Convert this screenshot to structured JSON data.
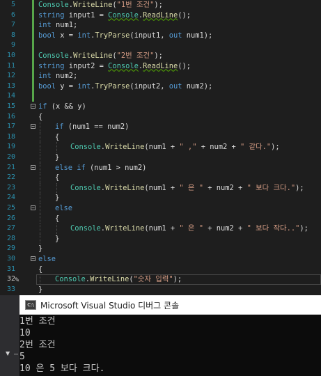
{
  "editor": {
    "line_numbers": [
      "5",
      "6",
      "7",
      "8",
      "9",
      "10",
      "11",
      "12",
      "13",
      "14",
      "15",
      "16",
      "17",
      "18",
      "19",
      "20",
      "21",
      "22",
      "23",
      "24",
      "25",
      "26",
      "27",
      "28",
      "29",
      "30",
      "31",
      "32",
      "33"
    ],
    "current_line": "32",
    "code": {
      "l5": {
        "a": "Console",
        "b": ".",
        "c": "WriteLine",
        "d": "(",
        "e": "\"1번 조건\"",
        "f": ");"
      },
      "l6": {
        "a": "string",
        "b": " input1 = ",
        "c": "Console",
        "d": ".",
        "e": "ReadLine",
        "f": "();"
      },
      "l7": {
        "a": "int",
        "b": " num1;"
      },
      "l8": {
        "a": "bool",
        "b": " x = ",
        "c": "int",
        "d": ".",
        "e": "TryParse",
        "f": "(input1, ",
        "g": "out",
        "h": " num1);"
      },
      "l10": {
        "a": "Console",
        "b": ".",
        "c": "WriteLine",
        "d": "(",
        "e": "\"2번 조건\"",
        "f": ");"
      },
      "l11": {
        "a": "string",
        "b": " input2 = ",
        "c": "Console",
        "d": ".",
        "e": "ReadLine",
        "f": "();"
      },
      "l12": {
        "a": "int",
        "b": " num2;"
      },
      "l13": {
        "a": "bool",
        "b": " y = ",
        "c": "int",
        "d": ".",
        "e": "TryParse",
        "f": "(input2, ",
        "g": "out",
        "h": " num2);"
      },
      "l15": {
        "a": "if",
        "b": " (x && y)"
      },
      "l16": {
        "a": "{"
      },
      "l17": {
        "a": "if",
        "b": " (num1 == num2)"
      },
      "l18": {
        "a": "{"
      },
      "l19": {
        "a": "Console",
        "b": ".",
        "c": "WriteLine",
        "d": "(num1 + ",
        "e": "\" ,\"",
        "f": " + num2 + ",
        "g": "\" 같다.\"",
        "h": ");"
      },
      "l20": {
        "a": "}"
      },
      "l21": {
        "a": "else if",
        "b": " (num1 > num2)"
      },
      "l22": {
        "a": "{"
      },
      "l23": {
        "a": "Console",
        "b": ".",
        "c": "WriteLine",
        "d": "(num1 + ",
        "e": "\" 은 \"",
        "f": " + num2 + ",
        "g": "\" 보다 크다.\"",
        "h": ");"
      },
      "l24": {
        "a": "}"
      },
      "l25": {
        "a": "else"
      },
      "l26": {
        "a": "{"
      },
      "l27": {
        "a": "Console",
        "b": ".",
        "c": "WriteLine",
        "d": "(num1 + ",
        "e": "\" 은 \"",
        "f": " + num2 + ",
        "g": "\" 보다 작다..\"",
        "h": ");"
      },
      "l28": {
        "a": "}"
      },
      "l29": {
        "a": "}"
      },
      "l30": {
        "a": "else"
      },
      "l31": {
        "a": "{"
      },
      "l32": {
        "a": "Console",
        "b": ".",
        "c": "WriteLine",
        "d": "(",
        "e": "\"숫자 입력\"",
        "f": ");"
      },
      "l33": {
        "a": "}"
      }
    }
  },
  "console": {
    "title": "Microsoft Visual Studio 디버그 콘솔",
    "icon_label": "C:\\",
    "lines": [
      "1번 조건",
      "10",
      "2번 조건",
      "5",
      "10 은 5 보다 크다."
    ]
  },
  "icons": {
    "console_icon": "console-app-icon",
    "pencil": "edit-pencil-icon",
    "fold": "collapse-icon"
  },
  "colors": {
    "keyword": "#569cd6",
    "string": "#d69d85",
    "type": "#4ec9b0",
    "method": "#dcdcaa",
    "line_number": "#2b91af",
    "changed_bar": "#57a64a",
    "background": "#1e1e1e"
  }
}
